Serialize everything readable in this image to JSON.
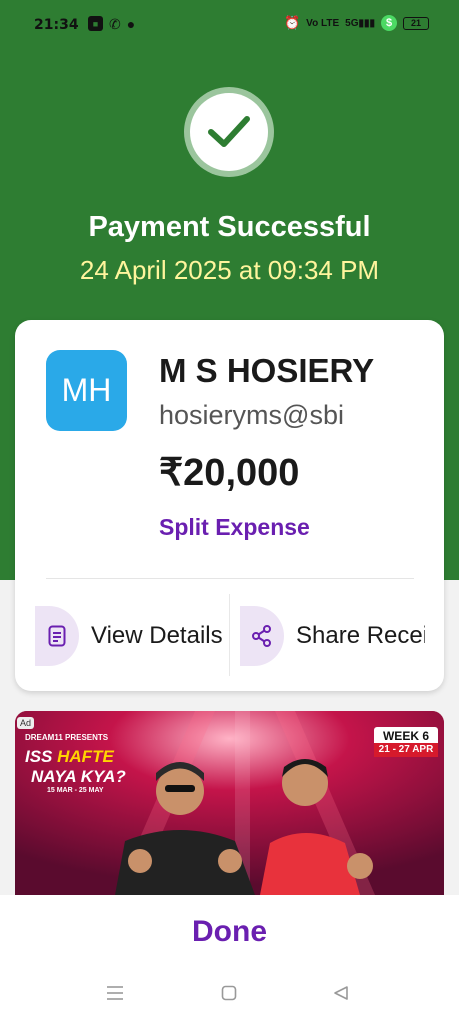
{
  "status_bar": {
    "time": "21:34",
    "network": "Vo LTE",
    "signal": "5G",
    "battery": "21"
  },
  "header": {
    "title": "Payment Successful",
    "datetime": "24 April 2025 at 09:34 PM"
  },
  "payee": {
    "initials": "MH",
    "name": "M S HOSIERY",
    "upi_id": "hosieryms@sbi",
    "amount": "₹20,000",
    "split_label": "Split Expense"
  },
  "actions": {
    "view_details": "View Details",
    "share_receipt": "Share Receipt"
  },
  "ad": {
    "tag": "Ad",
    "brand": "DREAM11 PRESENTS",
    "headline_1a": "ISS ",
    "headline_1b": "HAFTE",
    "headline_2": "NAYA KYA?",
    "dates": "15 MAR - 25 MAY",
    "week": "WEEK 6",
    "week_range": "21 - 27 APR"
  },
  "footer": {
    "done_label": "Done"
  },
  "colors": {
    "primary_green": "#2e7d32",
    "accent_purple": "#6a1fb0",
    "avatar_blue": "#2aa9e8",
    "date_yellow": "#fff59d"
  }
}
